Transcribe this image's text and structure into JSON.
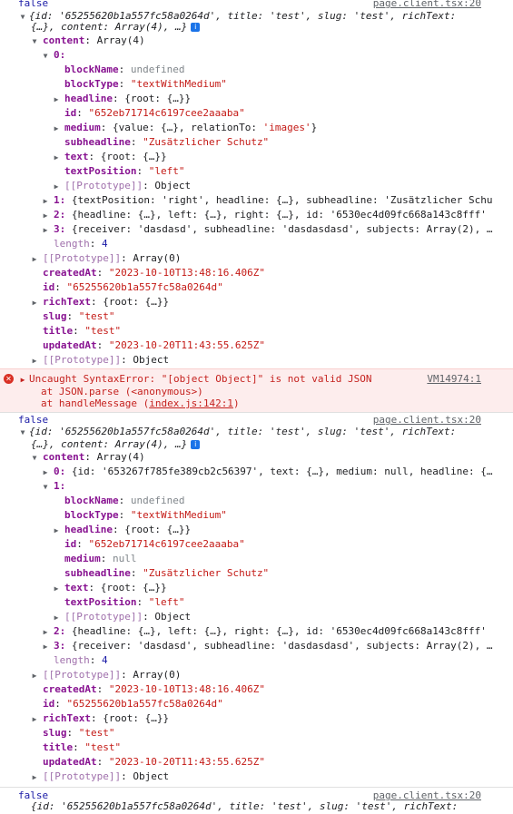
{
  "log1": {
    "value": "false",
    "source": "page.client.tsx:20",
    "summary_l1": "{id: '65255620b1a557fc58a0264d', title: 'test', slug: 'test', richText:",
    "summary_l2": "{…}, content: Array(4), …}",
    "content_key": "content",
    "content_val": "Array(4)",
    "item0_key": "0:",
    "item0_fields": [
      {
        "key": "blockName",
        "val": "undefined",
        "type": "undef"
      },
      {
        "key": "blockType",
        "val": "\"textWithMedium\"",
        "type": "str"
      },
      {
        "key": "headline",
        "val": "{root: {…}}",
        "type": "obj",
        "expandable": true
      },
      {
        "key": "id",
        "val": "\"652eb71714c6197cee2aaaba\"",
        "type": "str"
      },
      {
        "key": "medium",
        "val": "{value: {…}, relationTo: 'images'}",
        "type": "obj",
        "expandable": true
      },
      {
        "key": "subheadline",
        "val": "\"Zusätzlicher Schutz\"",
        "type": "str"
      },
      {
        "key": "text",
        "val": "{root: {…}}",
        "type": "obj",
        "expandable": true
      },
      {
        "key": "textPosition",
        "val": "\"left\"",
        "type": "str"
      },
      {
        "key": "[[Prototype]]",
        "val": "Object",
        "type": "proto",
        "expandable": true
      }
    ],
    "item1": "1: {textPosition: 'right', headline: {…}, subheadline: 'Zusätzlicher Schu",
    "item2": "2: {headline: {…}, left: {…}, right: {…}, id: '6530ec4d09fc668a143c8fff'",
    "item3": "3: {receiver: 'dasdasd', subheadline: 'dasdasdasd', subjects: Array(2), …",
    "length_key": "length",
    "length_val": "4",
    "arr_proto_key": "[[Prototype]]",
    "arr_proto_val": "Array(0)",
    "createdAt": "\"2023-10-10T13:48:16.406Z\"",
    "id": "\"65255620b1a557fc58a0264d\"",
    "richText": "{root: {…}}",
    "slug": "\"test\"",
    "title": "\"test\"",
    "updatedAt": "\"2023-10-20T11:43:55.625Z\"",
    "proto_val": "Object"
  },
  "error": {
    "line1": "Uncaught SyntaxError: \"[object Object]\" is not valid JSON",
    "line2": "at JSON.parse (<anonymous>)",
    "line3_prefix": "at handleMessage (",
    "line3_link": "index.js:142:1",
    "line3_suffix": ")",
    "source": "VM14974:1"
  },
  "log2": {
    "value": "false",
    "source": "page.client.tsx:20",
    "summary_l1": "{id: '65255620b1a557fc58a0264d', title: 'test', slug: 'test', richText:",
    "summary_l2": "{…}, content: Array(4), …}",
    "item0": "0: {id: '653267f785fe389cb2c56397', text: {…}, medium: null, headline: {…",
    "item1_key": "1:",
    "item1_fields": [
      {
        "key": "blockName",
        "val": "undefined",
        "type": "undef"
      },
      {
        "key": "blockType",
        "val": "\"textWithMedium\"",
        "type": "str"
      },
      {
        "key": "headline",
        "val": "{root: {…}}",
        "type": "obj",
        "expandable": true
      },
      {
        "key": "id",
        "val": "\"652eb71714c6197cee2aaaba\"",
        "type": "str"
      },
      {
        "key": "medium",
        "val": "null",
        "type": "undef"
      },
      {
        "key": "subheadline",
        "val": "\"Zusätzlicher Schutz\"",
        "type": "str"
      },
      {
        "key": "text",
        "val": "{root: {…}}",
        "type": "obj",
        "expandable": true
      },
      {
        "key": "textPosition",
        "val": "\"left\"",
        "type": "str"
      },
      {
        "key": "[[Prototype]]",
        "val": "Object",
        "type": "proto",
        "expandable": true
      }
    ],
    "item2": "2: {headline: {…}, left: {…}, right: {…}, id: '6530ec4d09fc668a143c8fff'",
    "item3": "3: {receiver: 'dasdasd', subheadline: 'dasdasdasd', subjects: Array(2), …"
  },
  "log3": {
    "value": "false",
    "source": "page.client.tsx:20",
    "summary_l1": "{id: '65255620b1a557fc58a0264d', title: 'test', slug: 'test', richText:"
  },
  "colors": {
    "string": "#c41a16",
    "key": "#881391",
    "number": "#1a1aa6",
    "error_bg": "#fdeded",
    "error_text": "#c5221f"
  }
}
